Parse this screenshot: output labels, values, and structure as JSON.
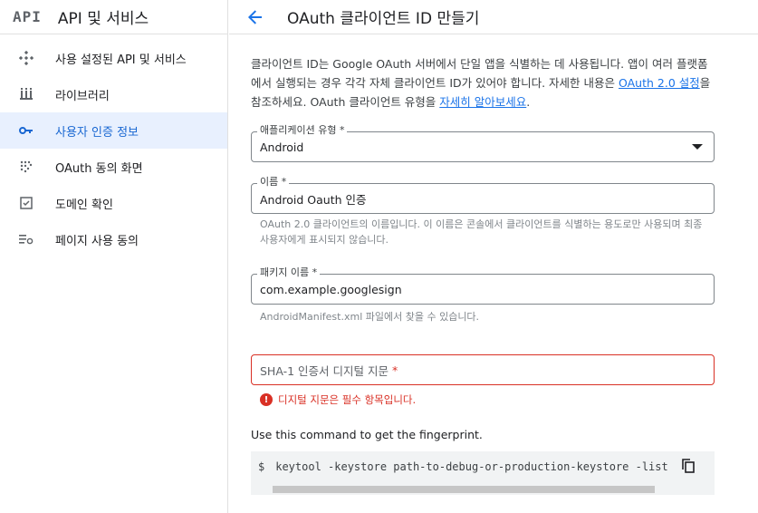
{
  "sidebar": {
    "logo": "API",
    "title": "API 및 서비스",
    "items": [
      {
        "label": "사용 설정된 API 및 서비스",
        "icon": "diamond-dots-icon"
      },
      {
        "label": "라이브러리",
        "icon": "library-icon"
      },
      {
        "label": "사용자 인증 정보",
        "icon": "key-icon",
        "active": true
      },
      {
        "label": "OAuth 동의 화면",
        "icon": "dots-grid-icon"
      },
      {
        "label": "도메인 확인",
        "icon": "checkbox-icon"
      },
      {
        "label": "페이지 사용 동의",
        "icon": "settings-list-icon"
      }
    ]
  },
  "header": {
    "title": "OAuth 클라이언트 ID 만들기",
    "back_icon": "arrow-back-icon"
  },
  "description": {
    "part1": "클라이언트 ID는 Google OAuth 서버에서 단일 앱을 식별하는 데 사용됩니다. 앱이 여러 플랫폼에서 실행되는 경우 각각 자체 클라이언트 ID가 있어야 합니다. 자세한 내용은 ",
    "link1": "OAuth 2.0 설정",
    "part2": "을 참조하세요. OAuth 클라이언트 유형을 ",
    "link2": "자세히 알아보세요",
    "part3": "."
  },
  "app_type": {
    "label": "애플리케이션 유형 *",
    "value": "Android"
  },
  "name_field": {
    "label": "이름 *",
    "value": "Android Oauth 인증",
    "hint": "OAuth 2.0 클라이언트의 이름입니다. 이 이름은 콘솔에서 클라이언트를 식별하는 용도로만 사용되며 최종 사용자에게 표시되지 않습니다."
  },
  "package_field": {
    "label": "패키지 이름 *",
    "value": "com.example.googlesign",
    "hint": "AndroidManifest.xml 파일에서 찾을 수 있습니다."
  },
  "sha_field": {
    "placeholder": "SHA-1 인증서 디지털 지문",
    "required_mark": "*",
    "error": "디지털 지문은 필수 항목입니다."
  },
  "command": {
    "intro": "Use this command to get the fingerprint.",
    "prompt": "$",
    "text": "keytool -keystore path-to-debug-or-production-keystore -list"
  },
  "colors": {
    "accent": "#1a73e8",
    "active_bg": "#e8f0fe",
    "error": "#d93025"
  }
}
